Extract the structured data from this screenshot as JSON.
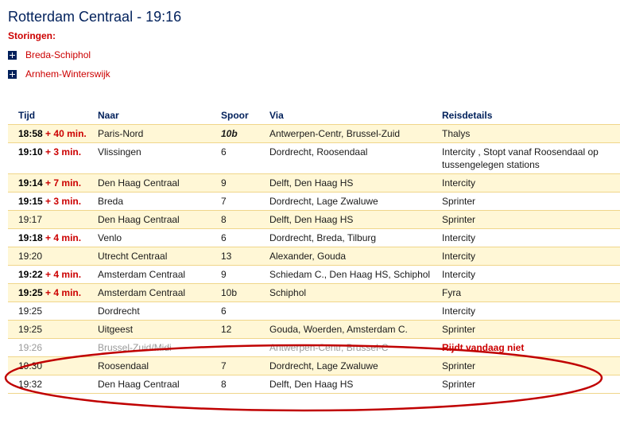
{
  "header": {
    "title": "Rotterdam Centraal - 19:16",
    "disruptions_label": "Storingen:",
    "disruptions": [
      "Breda-Schiphol",
      "Arnhem-Winterswijk"
    ]
  },
  "table": {
    "columns": [
      "Tijd",
      "Naar",
      "Spoor",
      "Via",
      "Reisdetails"
    ],
    "rows": [
      {
        "time": "18:58",
        "delay": "+ 40 min.",
        "destination": "Paris-Nord",
        "track": "10b",
        "track_changed": true,
        "via": "Antwerpen-Centr, Brussel-Zuid",
        "details": "Thalys"
      },
      {
        "time": "19:10",
        "delay": "+ 3 min.",
        "destination": "Vlissingen",
        "track": "6",
        "via": "Dordrecht, Roosendaal",
        "details": "Intercity , Stopt vanaf Roosendaal op tussengelegen stations"
      },
      {
        "time": "19:14",
        "delay": "+ 7 min.",
        "destination": "Den Haag Centraal",
        "track": "9",
        "via": "Delft, Den Haag HS",
        "details": "Intercity"
      },
      {
        "time": "19:15",
        "delay": "+ 3 min.",
        "destination": "Breda",
        "track": "7",
        "via": "Dordrecht, Lage Zwaluwe",
        "details": "Sprinter"
      },
      {
        "time": "19:17",
        "delay": "",
        "destination": "Den Haag Centraal",
        "track": "8",
        "via": "Delft, Den Haag HS",
        "details": "Sprinter"
      },
      {
        "time": "19:18",
        "delay": "+ 4 min.",
        "destination": "Venlo",
        "track": "6",
        "via": "Dordrecht, Breda, Tilburg",
        "details": "Intercity"
      },
      {
        "time": "19:20",
        "delay": "",
        "destination": "Utrecht Centraal",
        "track": "13",
        "via": "Alexander, Gouda",
        "details": "Intercity"
      },
      {
        "time": "19:22",
        "delay": "+ 4 min.",
        "destination": "Amsterdam Centraal",
        "track": "9",
        "via": "Schiedam C., Den Haag HS, Schiphol",
        "details": "Intercity"
      },
      {
        "time": "19:25",
        "delay": "+ 4 min.",
        "destination": "Amsterdam Centraal",
        "track": "10b",
        "via": "Schiphol",
        "details": "Fyra"
      },
      {
        "time": "19:25",
        "delay": "",
        "destination": "Dordrecht",
        "track": "6",
        "via": "",
        "details": "Intercity"
      },
      {
        "time": "19:25",
        "delay": "",
        "destination": "Uitgeest",
        "track": "12",
        "via": "Gouda, Woerden, Amsterdam C.",
        "details": "Sprinter"
      },
      {
        "time": "19:26",
        "delay": "",
        "destination": "Brussel-Zuid/Midi",
        "track": "",
        "via": "Antwerpen-Centr, Brussel-C",
        "details": "Rijdt vandaag niet",
        "cancelled": true
      },
      {
        "time": "19:30",
        "delay": "",
        "destination": "Roosendaal",
        "track": "7",
        "via": "Dordrecht, Lage Zwaluwe",
        "details": "Sprinter"
      },
      {
        "time": "19:32",
        "delay": "",
        "destination": "Den Haag Centraal",
        "track": "8",
        "via": "Delft, Den Haag HS",
        "details": "Sprinter"
      }
    ]
  },
  "colors": {
    "header_blue": "#00205b",
    "alert_red": "#cc0000",
    "row_highlight": "#fff7d6",
    "annotation_red": "#c00000"
  }
}
